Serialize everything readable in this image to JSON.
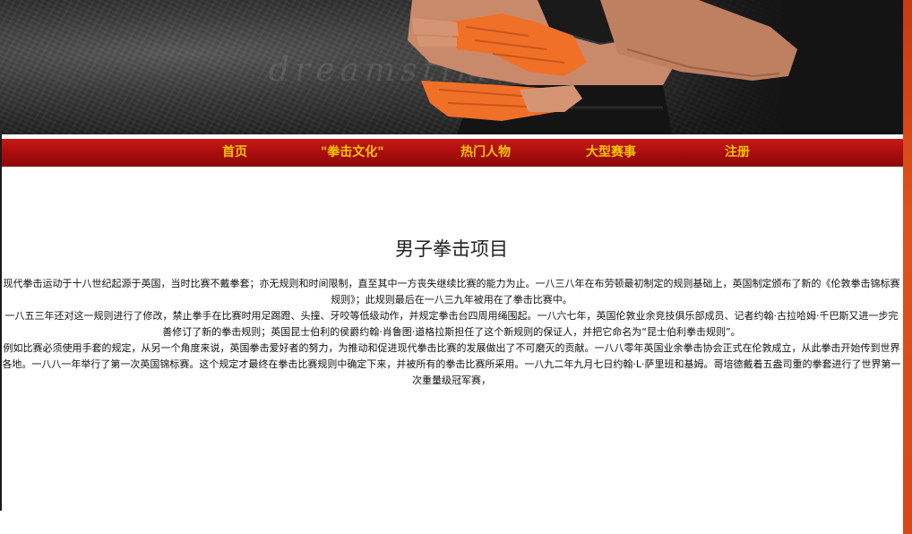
{
  "hero": {
    "watermark_text": "dreamstime",
    "colors": {
      "background": "#2a2a2a",
      "wraps": "#f07028",
      "skin": "#c98a6c"
    }
  },
  "nav": {
    "items": [
      {
        "label": "首页"
      },
      {
        "label": "\"拳击文化\""
      },
      {
        "label": "热门人物"
      },
      {
        "label": "大型赛事"
      },
      {
        "label": "注册"
      }
    ],
    "colors": {
      "bar": "#a80c0c",
      "text": "#f2c400"
    }
  },
  "main": {
    "title": "男子拳击项目",
    "paragraphs": [
      "现代拳击运动于十八世纪起源于英国，当时比赛不戴拳套；亦无规则和时间限制，直至其中一方丧失继续比赛的能力为止。一八三八年在布劳顿最初制定的规则基础上，英国制定颁布了新的《伦敦拳击锦标赛规则》；此规则最后在一八三九年被用在了拳击比赛中。",
      "一八五三年还对这一规则进行了修改，禁止拳手在比赛时用足踢蹬、头撞、牙咬等低级动作，并规定拳击台四周用绳围起。一八六七年，英国伦敦业余竞技俱乐部成员、记者约翰·古拉哈姆·千巴斯又进一步完善修订了新的拳击规则；英国昆士伯利的侯爵约翰·肖鲁图·道格拉斯担任了这个新规则的保证人，并把它命名为“昆士伯利拳击规则”。",
      "例如比赛必须使用手套的规定，从另一个角度来说，英国拳击爱好者的努力，为推动和促进现代拳击比赛的发展做出了不可磨灭的贡献。一八八零年英国业余拳击协会正式在伦敦成立，从此拳击开始传到世界各地。一八八一年举行了第一次英国锦标赛。这个规定才最终在拳击比赛规则中确定下来，并被所有的拳击比赛所采用。一八九二年九月七日约翰·L·萨里班和基姆。哥培德戴着五盎司重的拳套进行了世界第一次重量级冠军赛，"
    ]
  }
}
